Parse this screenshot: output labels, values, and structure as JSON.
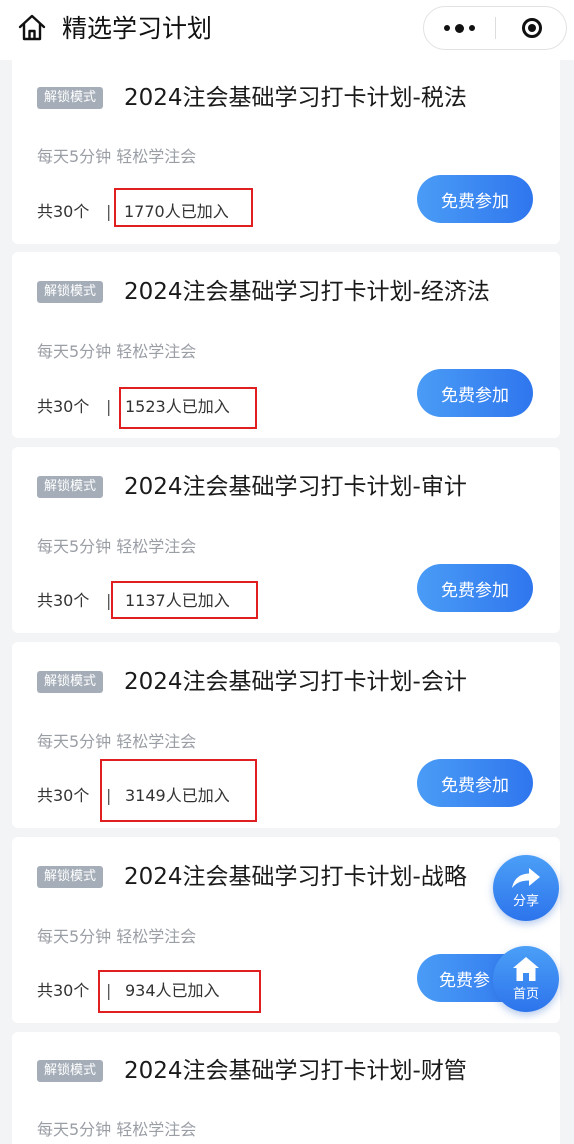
{
  "header": {
    "title": "精选学习计划",
    "icons": {
      "home": "home-icon",
      "more": "more-dots-icon",
      "close": "close-circle-icon"
    }
  },
  "cards": [
    {
      "tag": "解锁模式",
      "title": "2024注会基础学习打卡计划-税法",
      "subtitle": "每天5分钟 轻松学注会",
      "count": "共30个",
      "separator": "|",
      "joined": "1770人已加入",
      "button": "免费参加"
    },
    {
      "tag": "解锁模式",
      "title": "2024注会基础学习打卡计划-经济法",
      "subtitle": "每天5分钟 轻松学注会",
      "count": "共30个",
      "separator": "|",
      "joined": "1523人已加入",
      "button": "免费参加"
    },
    {
      "tag": "解锁模式",
      "title": "2024注会基础学习打卡计划-审计",
      "subtitle": "每天5分钟 轻松学注会",
      "count": "共30个",
      "separator": "|",
      "joined": "1137人已加入",
      "button": "免费参加"
    },
    {
      "tag": "解锁模式",
      "title": "2024注会基础学习打卡计划-会计",
      "subtitle": "每天5分钟 轻松学注会",
      "count": "共30个",
      "separator": "|",
      "joined": "3149人已加入",
      "button": "免费参加"
    },
    {
      "tag": "解锁模式",
      "title": "2024注会基础学习打卡计划-战略",
      "subtitle": "每天5分钟 轻松学注会",
      "count": "共30个",
      "separator": "|",
      "joined": "934人已加入",
      "button": "免费参"
    },
    {
      "tag": "解锁模式",
      "title": "2024注会基础学习打卡计划-财管",
      "subtitle": "每天5分钟 轻松学注会"
    }
  ],
  "floating": {
    "share": {
      "label": "分享",
      "icon": "share-arrow-icon"
    },
    "home": {
      "label": "首页",
      "icon": "home-icon"
    }
  },
  "colors": {
    "accent": "#2f7cf0",
    "tag_bg": "#a5aeb8",
    "highlight": "#e02020"
  }
}
